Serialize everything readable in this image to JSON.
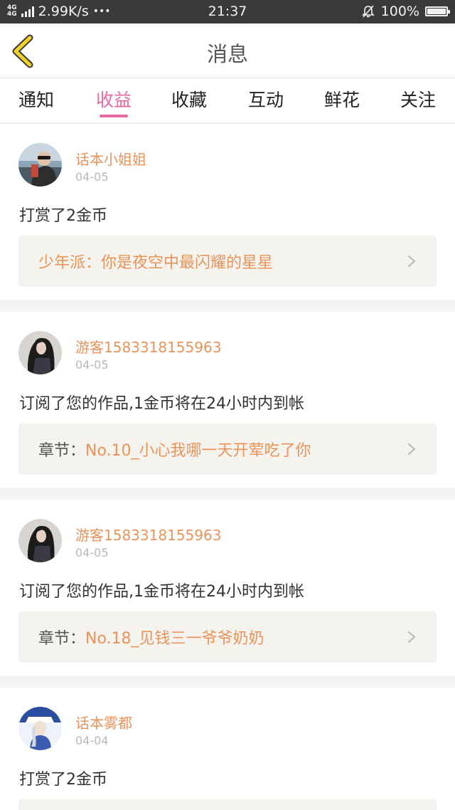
{
  "status_bar": {
    "network_types": [
      "4G",
      "4G"
    ],
    "speed": "2.99K/s",
    "dots": "•••",
    "time": "21:37",
    "battery": "100%",
    "icons": [
      "signal-icon",
      "mute-bell-icon",
      "battery-icon"
    ]
  },
  "header": {
    "title": "消息",
    "back_icon": "chevron-left-icon"
  },
  "tabs": [
    {
      "label": "通知"
    },
    {
      "label": "收益"
    },
    {
      "label": "收藏"
    },
    {
      "label": "互动"
    },
    {
      "label": "鲜花"
    },
    {
      "label": "关注"
    }
  ],
  "active_tab": "收益",
  "messages": [
    {
      "user": "话本小姐姐",
      "date": "04-05",
      "text": "打赏了2金币",
      "ref_prefix": "",
      "ref_link": "少年派：你是夜空中最闪耀的星星"
    },
    {
      "user": "游客1583318155963",
      "date": "04-05",
      "text": "订阅了您的作品,1金币将在24小时内到帐",
      "ref_prefix": "章节：",
      "ref_link": "No.10_小心我哪一天开荤吃了你"
    },
    {
      "user": "游客1583318155963",
      "date": "04-05",
      "text": "订阅了您的作品,1金币将在24小时内到帐",
      "ref_prefix": "章节：",
      "ref_link": "No.18_见钱三一爷爷奶奶"
    },
    {
      "user": "话本雾都",
      "date": "04-04",
      "text": "打赏了2金币"
    }
  ],
  "colors": {
    "accent_pink": "#e86aa0",
    "accent_orange": "#e8945a",
    "back_arrow": "#f2d22a",
    "ref_background": "#f5f3ee"
  }
}
